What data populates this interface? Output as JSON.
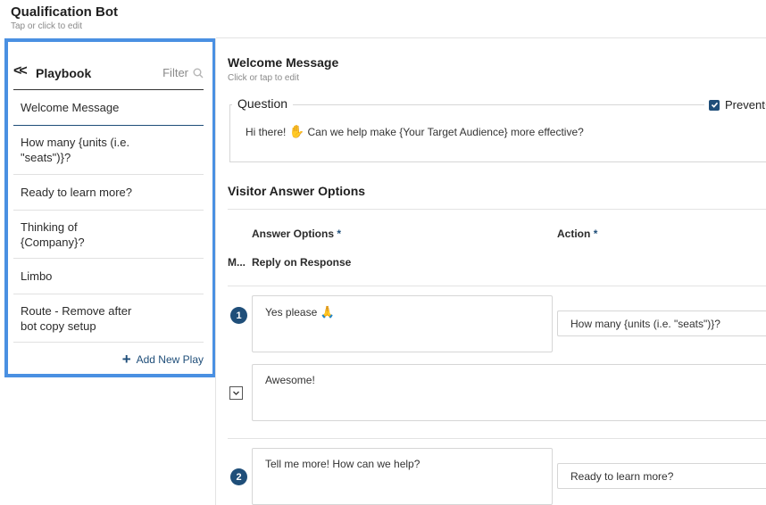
{
  "app": {
    "title": "Qualification Bot",
    "subtitle": "Tap or click to edit"
  },
  "sidebar": {
    "title": "Playbook",
    "filter_label": "Filter",
    "items": [
      {
        "label": "Welcome Message"
      },
      {
        "label": "How many {units (i.e. \"seats\")}?"
      },
      {
        "label": "Ready to learn more?"
      },
      {
        "label": "Thinking of {Company}?"
      },
      {
        "label": "Limbo"
      },
      {
        "label": "Route - Remove after bot copy setup"
      }
    ],
    "add_label": "Add New Play"
  },
  "main": {
    "title": "Welcome Message",
    "subtitle": "Click or tap to edit",
    "question": {
      "legend": "Question",
      "prevent_label": "Prevent",
      "prevent_checked": true,
      "text_before": "Hi there!",
      "text_after": "Can we help make {Your Target Audience} more effective?"
    },
    "visitor_answers": {
      "title": "Visitor Answer Options",
      "col_answer": "Answer Options",
      "col_action": "Action",
      "required_mark": "*",
      "m_label": "M...",
      "reply_label": "Reply on Response",
      "options": [
        {
          "number": "1",
          "answer": "Yes please",
          "action": "How many {units (i.e. \"seats\")}?",
          "reply": "Awesome!"
        },
        {
          "number": "2",
          "answer": "Tell me more! How can we help?",
          "action": "Ready to learn more?"
        }
      ]
    }
  },
  "colors": {
    "accent": "#4a90e2",
    "primary": "#1f4e79"
  }
}
